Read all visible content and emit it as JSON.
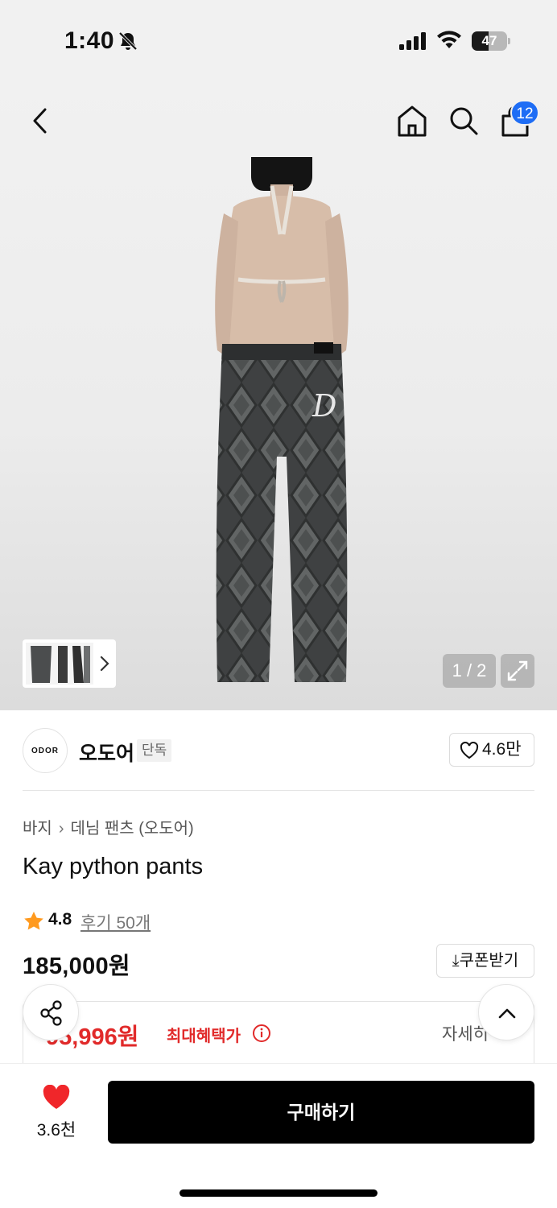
{
  "status_bar": {
    "time": "1:40",
    "battery": "47",
    "battery_level": 0.47
  },
  "gallery": {
    "counter": "1 / 2",
    "cart_count": "12"
  },
  "brand": {
    "logo_text": "ODOR",
    "name": "오도어",
    "tag": "단독",
    "likes": "4.6만"
  },
  "breadcrumb": {
    "category": "바지",
    "subcategory": "데님 팬츠 (오도어)"
  },
  "product": {
    "title": "Kay python pants",
    "rating": "4.8",
    "reviews": "후기 50개",
    "price": "185,000원",
    "coupon": "쿠폰받기",
    "benefit_price": "95,996원",
    "benefit_label": "최대혜택가",
    "detail": "자세히"
  },
  "bottom_bar": {
    "wish_count": "3.6천",
    "buy_label": "구매하기"
  },
  "colors": {
    "accent_blue": "#1e6df5",
    "benefit_red": "#e12a2a",
    "heart_red": "#f0262a",
    "star_orange": "#ff9a1f"
  }
}
